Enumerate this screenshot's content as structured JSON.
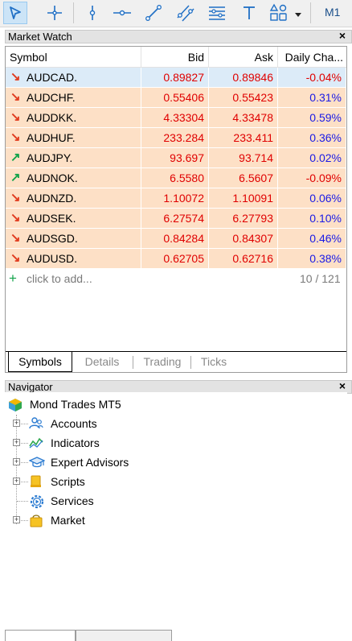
{
  "toolbar": {
    "tools": [
      "cursor-icon",
      "crosshair-icon",
      "vertical-line-icon",
      "horizontal-line-icon",
      "trend-line-icon",
      "equidistant-channel-icon",
      "fibonacci-icon",
      "text-icon",
      "shapes-icon",
      "dropdown-arrow-icon"
    ],
    "timeframe": "M1"
  },
  "market_watch": {
    "title": "Market Watch",
    "close": "×",
    "columns": {
      "symbol": "Symbol",
      "bid": "Bid",
      "ask": "Ask",
      "change": "Daily Cha..."
    },
    "rows": [
      {
        "symbol": "AUDCAD.",
        "bid": "0.89827",
        "ask": "0.89846",
        "change": "-0.04%",
        "direction": "down",
        "selected": true
      },
      {
        "symbol": "AUDCHF.",
        "bid": "0.55406",
        "ask": "0.55423",
        "change": "0.31%",
        "direction": "down",
        "selected": false
      },
      {
        "symbol": "AUDDKK.",
        "bid": "4.33304",
        "ask": "4.33478",
        "change": "0.59%",
        "direction": "down",
        "selected": false
      },
      {
        "symbol": "AUDHUF.",
        "bid": "233.284",
        "ask": "233.411",
        "change": "0.36%",
        "direction": "down",
        "selected": false
      },
      {
        "symbol": "AUDJPY.",
        "bid": "93.697",
        "ask": "93.714",
        "change": "0.02%",
        "direction": "up",
        "selected": false
      },
      {
        "symbol": "AUDNOK.",
        "bid": "6.5580",
        "ask": "6.5607",
        "change": "-0.09%",
        "direction": "up",
        "selected": false
      },
      {
        "symbol": "AUDNZD.",
        "bid": "1.10072",
        "ask": "1.10091",
        "change": "0.06%",
        "direction": "down",
        "selected": false
      },
      {
        "symbol": "AUDSEK.",
        "bid": "6.27574",
        "ask": "6.27793",
        "change": "0.10%",
        "direction": "down",
        "selected": false
      },
      {
        "symbol": "AUDSGD.",
        "bid": "0.84284",
        "ask": "0.84307",
        "change": "0.46%",
        "direction": "down",
        "selected": false
      },
      {
        "symbol": "AUDUSD.",
        "bid": "0.62705",
        "ask": "0.62716",
        "change": "0.38%",
        "direction": "down",
        "selected": false
      }
    ],
    "add_placeholder": "click to add...",
    "count": "10 / 121",
    "tabs": [
      "Symbols",
      "Details",
      "Trading",
      "Ticks"
    ],
    "active_tab": "Symbols"
  },
  "navigator": {
    "title": "Navigator",
    "close": "×",
    "root": "Mond Trades MT5",
    "items": [
      {
        "label": "Accounts",
        "icon": "accounts-icon",
        "expandable": true
      },
      {
        "label": "Indicators",
        "icon": "indicators-icon",
        "expandable": true
      },
      {
        "label": "Expert Advisors",
        "icon": "expert-advisors-icon",
        "expandable": true
      },
      {
        "label": "Scripts",
        "icon": "scripts-icon",
        "expandable": true
      },
      {
        "label": "Services",
        "icon": "services-icon",
        "expandable": false
      },
      {
        "label": "Market",
        "icon": "market-icon",
        "expandable": true
      }
    ]
  },
  "colors": {
    "down_arrow": "#e03a1e",
    "up_arrow": "#12a34a",
    "price_red": "#e00000",
    "change_blue": "#1a1ae6",
    "row_bg": "#fde0c6",
    "selected_row_bg": "#dcebf8"
  }
}
